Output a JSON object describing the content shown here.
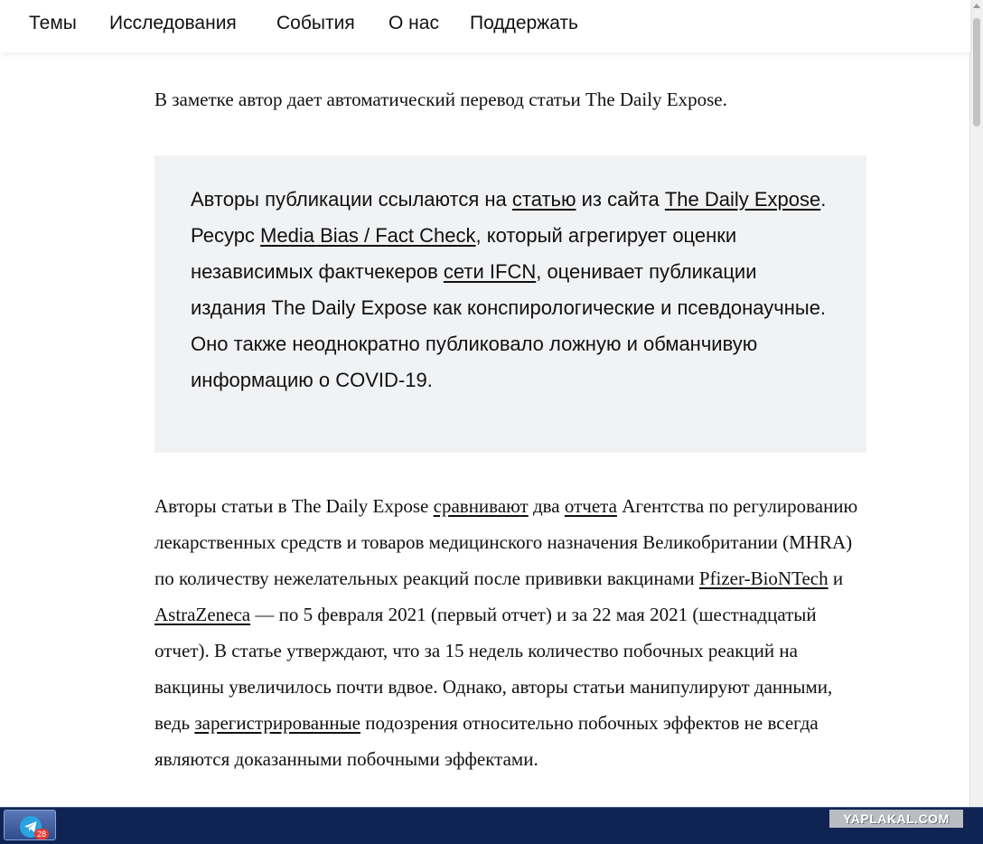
{
  "nav": {
    "items": [
      "Темы",
      "Исследования",
      "События",
      "О нас",
      "Поддержать"
    ]
  },
  "article": {
    "lead": "В заметке автор дает автоматический перевод статьи The Daily Expose.",
    "callout": {
      "t1": "Авторы публикации ссылаются на ",
      "l1": "статью",
      "t2": " из сайта ",
      "l2": "The Daily Expose",
      "t3": ". Ресурс ",
      "l3": "Media Bias / Fact Check",
      "t4": ", который агрегирует оценки независимых фактчекеров ",
      "l4": "сети IFCN",
      "t5": ", оценивает публикации издания The Daily Expose как конспирологические и псевдонаучные. Оно также неоднократно публиковало ложную и обманчивую информацию о COVID-19."
    },
    "para": {
      "t1": "Авторы статьи в The Daily Expose ",
      "l1": "сравнивают",
      "t2": " два ",
      "l2": "отчета",
      "t3": " Агентства по регулированию лекарственных средств и товаров медицинского назначения Великобритании (MHRA) по количеству нежелательных реакций после прививки вакцинами ",
      "l3": "Pfizer-BioNTech",
      "t4": " и ",
      "l4": "AstraZeneca",
      "t5": " — по 5 февраля 2021 (первый отчет) и за 22 мая 2021 (шестнадцатый отчет). В статье утверждают, что за 15 недель количество побочных реакций на вакцины увеличилось почти вдвое. Однако, авторы статьи манипулируют данными, ведь ",
      "l5": "зарегистрированные",
      "t6": " подозрения относительно побочных эффектов не всегда являются доказанными побочными эффектами."
    }
  },
  "taskbar": {
    "telegram_badge": "28",
    "watermark": "YAPLAKAL.COM"
  },
  "icons": {
    "telegram": "telegram-icon"
  },
  "colors": {
    "callout_bg": "#f1f2f4",
    "taskbar_bg": "#0f2452",
    "telegram_blue": "#2aa3e0"
  }
}
